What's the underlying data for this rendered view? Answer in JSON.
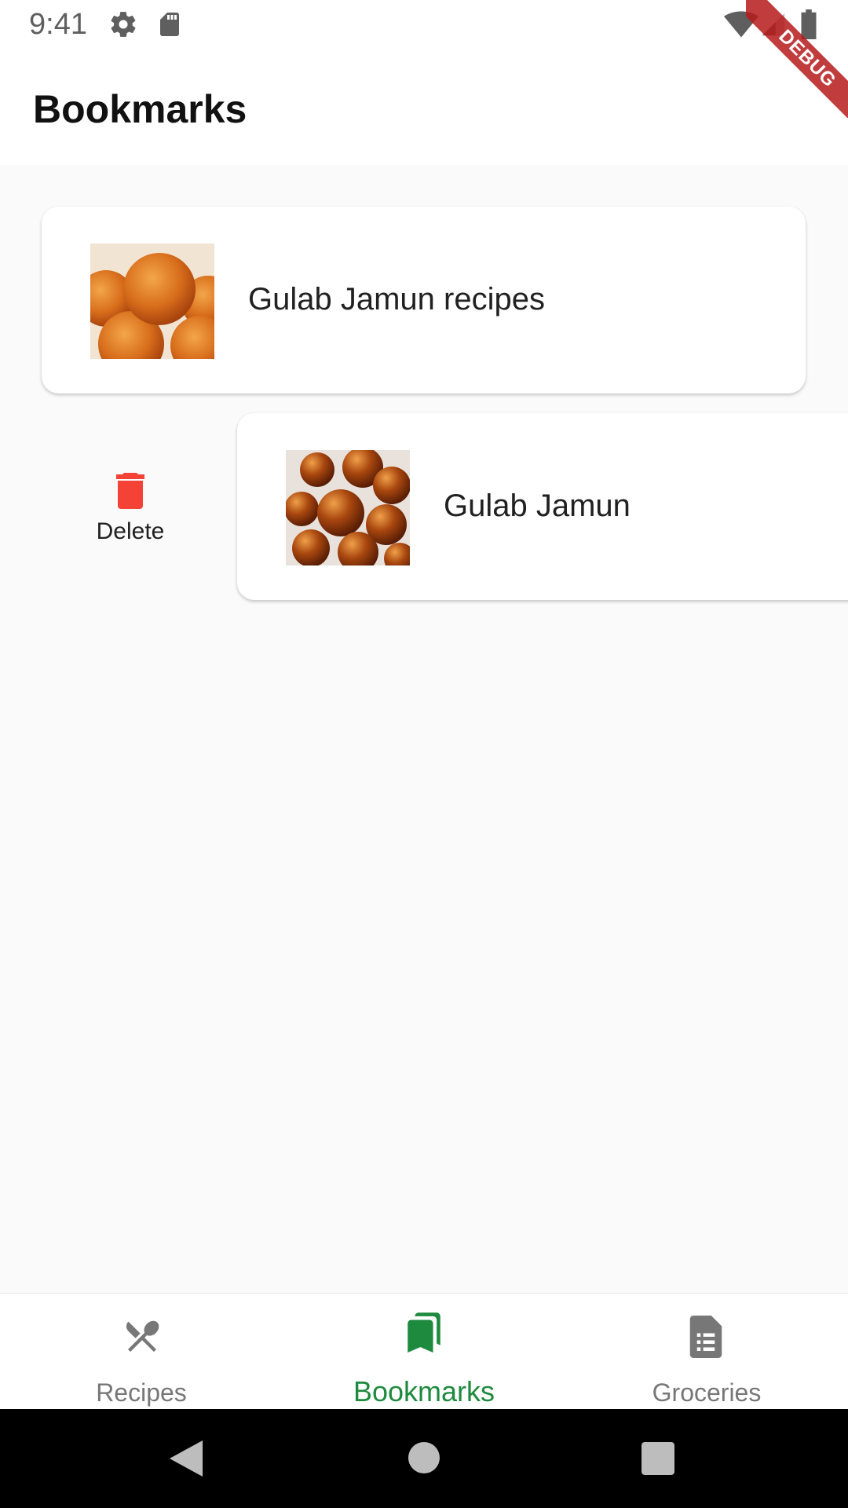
{
  "status_bar": {
    "time": "9:41",
    "icons": [
      "settings-icon",
      "sd-card-icon",
      "wifi-icon",
      "cell-signal-icon",
      "battery-icon"
    ]
  },
  "app_bar": {
    "title": "Bookmarks",
    "debug_banner": "DEBUG"
  },
  "bookmarks": [
    {
      "title": "Gulab Jamun recipes",
      "image": "gulab-jamun-photo"
    },
    {
      "title": "Gulab Jamun",
      "image": "gulab-jamun-syrup-photo"
    }
  ],
  "swipe_action": {
    "label": "Delete",
    "icon": "trash-icon",
    "color": "#f44336"
  },
  "bottom_nav": {
    "items": [
      {
        "label": "Recipes",
        "icon": "fork-knife-icon",
        "active": false
      },
      {
        "label": "Bookmarks",
        "icon": "bookmarks-icon",
        "active": true
      },
      {
        "label": "Groceries",
        "icon": "list-document-icon",
        "active": false
      }
    ],
    "active_color": "#1e8a3e",
    "inactive_color": "#777777"
  },
  "system_nav": {
    "buttons": [
      "back-icon",
      "home-icon",
      "recents-icon"
    ]
  }
}
